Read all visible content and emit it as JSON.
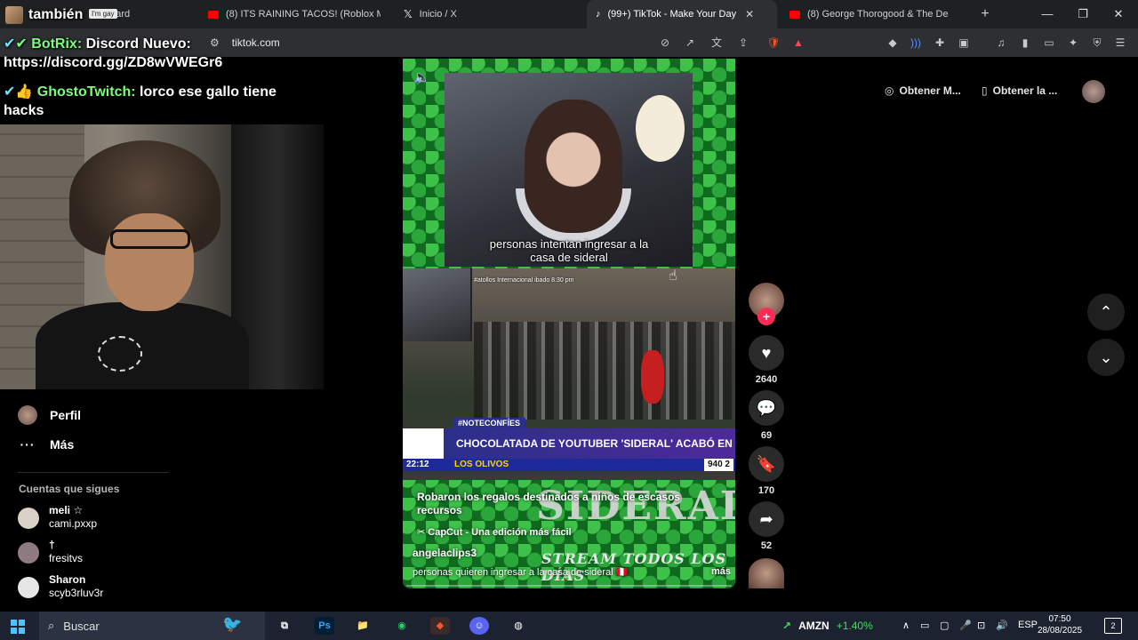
{
  "browser": {
    "tabs": [
      {
        "label": "board",
        "favicon_color": "#4a4a4a",
        "active": false
      },
      {
        "label": "(8) ITS RAINING TACOS! (Roblox Mus",
        "favicon_color": "#ff0000",
        "active": false
      },
      {
        "label": "Inicio / X",
        "favicon_color": "#000000",
        "active": false
      },
      {
        "label": "(99+) TikTok - Make Your Day",
        "favicon_color": "#111111",
        "active": true
      },
      {
        "label": "(8) George Thorogood & The De",
        "favicon_color": "#ff0000",
        "active": false
      }
    ],
    "close_tab": "✕",
    "new_tab": "+",
    "window_controls": {
      "minimize": "—",
      "maximize": "❐",
      "close": "✕"
    },
    "url": "tiktok.com"
  },
  "overlay": {
    "chat_line_1_user": "también",
    "chat_chip": "I'm gay",
    "chat_line_2_user": "BotRix:",
    "chat_line_2_text": "Discord Nuevo:",
    "chat_line_2_link": "https://discord.gg/ZD8wVWEGr6",
    "chat_line_3_user": "GhostoTwitch:",
    "chat_line_3_text": "lorco ese gallo tiene",
    "chat_line_3_cont": "hacks"
  },
  "sidebar": {
    "profile_label": "Perfil",
    "more_label": "Más",
    "more_icon": "···",
    "following_heading": "Cuentas que sigues",
    "following": [
      {
        "name": "meli ☆",
        "handle": "cami.pxxp",
        "avatar_color": "#d9d0c7"
      },
      {
        "name": "†",
        "handle": "fresitvs",
        "avatar_color": "#8f7b84"
      },
      {
        "name": "Sharon",
        "handle": "scyb3rluv3r",
        "avatar_color": "#e6e6e6"
      }
    ]
  },
  "video": {
    "top_caption_line1": "personas intentan ingresar a la",
    "top_caption_line2": "casa de sideral",
    "inset_label": "#atollos Internacional  ibado 8:30 pm",
    "news_tag": "#NOTECONFÍES",
    "news_headline": "CHOCOLATADA DE YOUTUBER 'SIDERAL' ACABÓ EN DESA",
    "news_time": "22:12",
    "news_place": "LOS OLIVOS",
    "news_phone": "940 2",
    "watermark_title": "SIDERAL",
    "watermark_sub": "STREAM TODOS LOS DÍAS",
    "description": "Robaron los regalos destinados a niños de escasos recursos",
    "music": "CapCut - Una edición más fácil",
    "author": "angelaclips3",
    "more_text": "personas quieren ingresar a la casa de sideral 🇵🇪",
    "more_link": "más"
  },
  "actions": {
    "follow_plus": "+",
    "likes": "2640",
    "comments": "69",
    "saves": "170",
    "shares": "52"
  },
  "right_panel": {
    "get_app_label": "Obtener M...",
    "get_desktop_label": "Obtener la ...",
    "scroll_up": "⌃",
    "scroll_down": "⌄"
  },
  "taskbar": {
    "search_placeholder": "Buscar",
    "stock_ticker": "AMZN",
    "stock_change": "+1.40%",
    "language": "ESP",
    "time": "07:50",
    "date": "28/08/2025",
    "notifications": "2",
    "photoshop_label": "Ps"
  }
}
